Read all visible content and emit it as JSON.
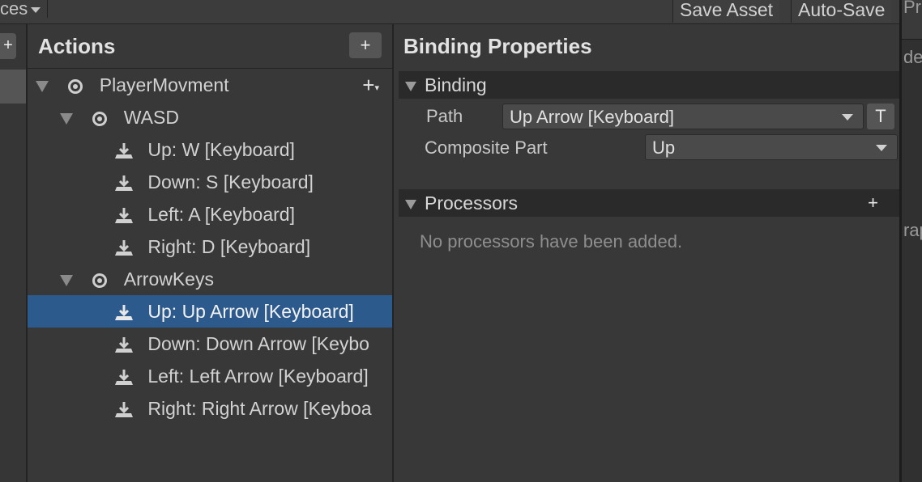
{
  "toolbar": {
    "schemes_label": "ces",
    "save_asset": "Save Asset",
    "auto_save": "Auto-Save"
  },
  "action_maps": {
    "add_label": "+"
  },
  "actions": {
    "title": "Actions",
    "add_label": "+",
    "rows": [
      {
        "label": "PlayerMovment",
        "kind": "action"
      },
      {
        "label": "WASD",
        "kind": "composite"
      },
      {
        "label": "Up: W [Keyboard]",
        "kind": "binding"
      },
      {
        "label": "Down: S [Keyboard]",
        "kind": "binding"
      },
      {
        "label": "Left: A [Keyboard]",
        "kind": "binding"
      },
      {
        "label": "Right: D [Keyboard]",
        "kind": "binding"
      },
      {
        "label": "ArrowKeys",
        "kind": "composite"
      },
      {
        "label": "Up: Up Arrow [Keyboard]",
        "kind": "binding",
        "selected": true
      },
      {
        "label": "Down: Down Arrow [Keybo",
        "kind": "binding"
      },
      {
        "label": "Left: Left Arrow [Keyboard]",
        "kind": "binding"
      },
      {
        "label": "Right: Right Arrow [Keyboa",
        "kind": "binding"
      }
    ],
    "add_binding_glyph": "+"
  },
  "properties": {
    "title": "Binding Properties",
    "binding_section": "Binding",
    "path_label": "Path",
    "path_value": "Up Arrow [Keyboard]",
    "t_button": "T",
    "composite_part_label": "Composite Part",
    "composite_part_value": "Up",
    "processors_section": "Processors",
    "processors_add": "+",
    "no_processors": "No processors have been added."
  },
  "right_edge": {
    "top_text": "Pr",
    "mid_text": "de",
    "low_text": "rap"
  },
  "colors": {
    "selection": "#2d5a8d",
    "panel": "#383838",
    "section_header": "#2a2a2a"
  }
}
